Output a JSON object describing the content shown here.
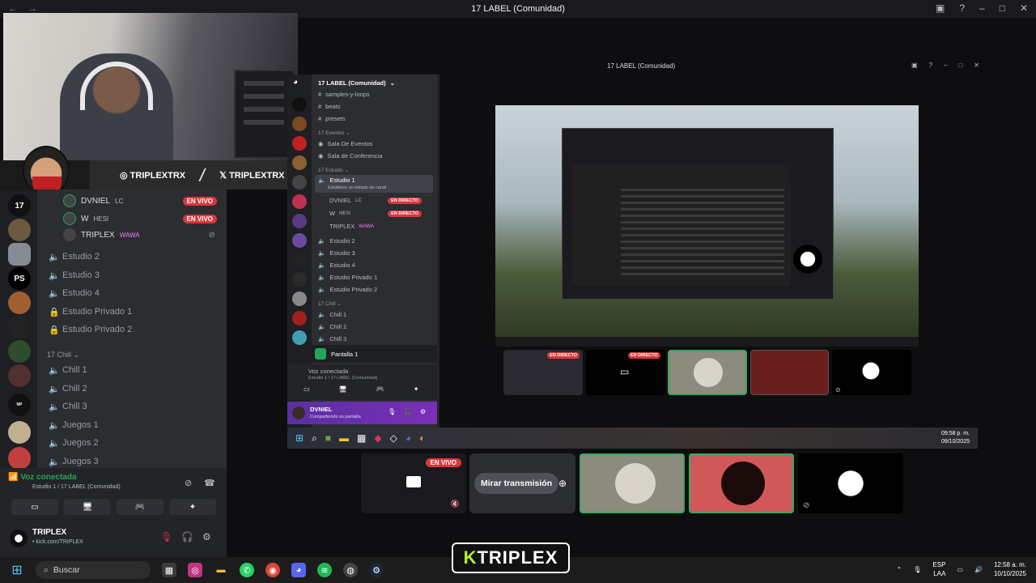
{
  "window": {
    "title": "17 LABEL (Comunidad)"
  },
  "webcam_overlay": {
    "instagram": "TRIPLEXTRX",
    "x": "TRIPLEXTRX"
  },
  "left_voice": {
    "users": [
      {
        "name": "DVNIEL",
        "tag": "LC",
        "badge": "EN VIVO"
      },
      {
        "name": "W",
        "tag": "HESI",
        "badge": "EN VIVO"
      },
      {
        "name": "TRIPLEX",
        "tag": "WAWA",
        "badge": ""
      }
    ],
    "channels_a": [
      "Estudio 2",
      "Estudio 3",
      "Estudio 4",
      "Estudio Privado 1",
      "Estudio Privado 2"
    ],
    "category_chill": "17 Chill",
    "channels_b": [
      "Chill 1",
      "Chill 2",
      "Chill 3",
      "Juegos 1",
      "Juegos 2",
      "Juegos 3"
    ],
    "voice_status": "Voz conectada",
    "voice_sub": "Estudio 1 / 17 LABEL (Comunidad)",
    "user_name": "TRIPLEX",
    "user_sub": "• kick.com/TRIPLEX"
  },
  "inner": {
    "server_name": "17 LABEL (Comunidad)",
    "top_channels": [
      "samples-y-loops",
      "beats",
      "presets"
    ],
    "cat_eventos": "17 Eventos",
    "eventos": [
      "Sala De Eventos",
      "Sala de Conferencia"
    ],
    "cat_estudio": "17 Estudio",
    "estudio1": "Estudio 1",
    "estudio1_sub": "Establece un estado de canal",
    "users": [
      {
        "name": "DVNIEL",
        "tag": "LC",
        "badge": "EN DIRECTO"
      },
      {
        "name": "W",
        "tag": "HESI",
        "badge": "EN DIRECTO"
      },
      {
        "name": "TRIPLEX",
        "tag": "WAWA",
        "badge": ""
      }
    ],
    "estudio_more": [
      "Estudio 2",
      "Estudio 3",
      "Estudio 4",
      "Estudio Privado 1",
      "Estudio Privado 2"
    ],
    "cat_chill": "17 Chill",
    "chill": [
      "Chill 1",
      "Chill 2",
      "Chill 3"
    ],
    "screen_label": "Pantalla 1",
    "voice_status": "Voz conectada",
    "voice_sub": "Estudio 1 / 17 LABEL (Comunidad)",
    "user_name": "DVNIEL",
    "user_sub": "Compartiendo su pantalla",
    "live_badge": "EN DIRECTO",
    "clock_time": "09:58 p. m.",
    "clock_date": "09/10/2025"
  },
  "bottom_row": {
    "live_badge": "EN VIVO",
    "watch_button": "Mirar transmisión"
  },
  "taskbar": {
    "search_placeholder": "Buscar",
    "lang": "ESP",
    "lang_sub": "LAA",
    "time": "12:58 a. m.",
    "date": "10/10/2025"
  },
  "logo": {
    "k": "K",
    "text": "TRIPLEX"
  }
}
